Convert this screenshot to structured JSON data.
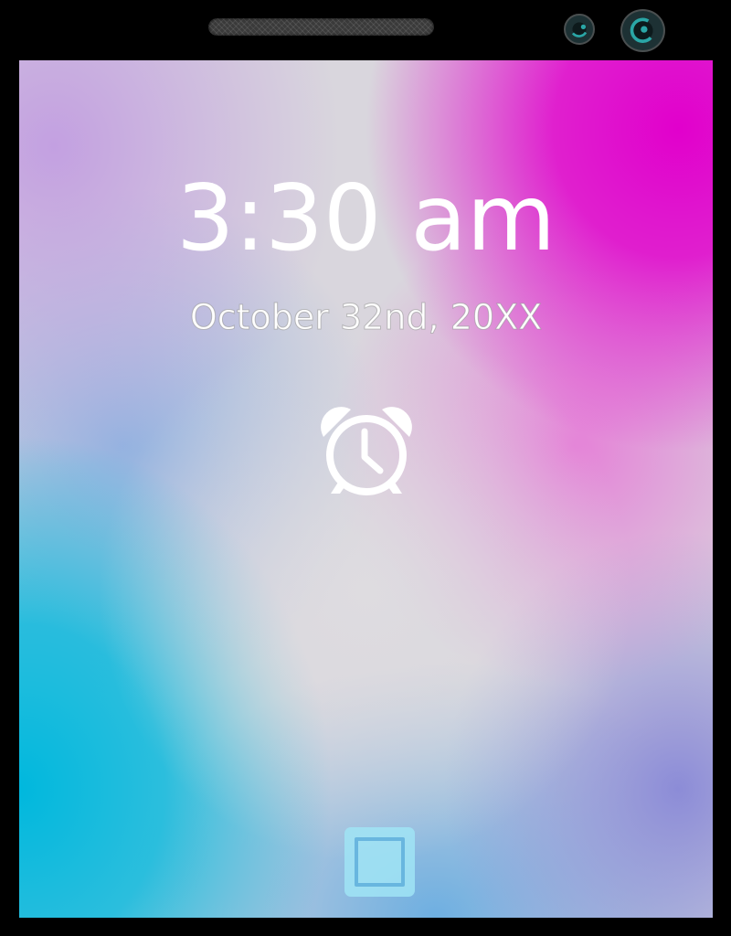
{
  "lock_screen": {
    "time": "3:30 am",
    "date": "October 32nd, 20XX"
  },
  "icons": {
    "alarm": "alarm-clock-icon",
    "home": "home-button-icon",
    "speaker": "speaker-grille",
    "camera_small": "front-camera-icon",
    "camera_large": "front-camera-lens-icon"
  },
  "colors": {
    "bezel": "#000000",
    "text": "#ffffff",
    "magenta": "#e100cc",
    "cyan": "#00b8dd",
    "home_button": "#a0e4f5"
  }
}
